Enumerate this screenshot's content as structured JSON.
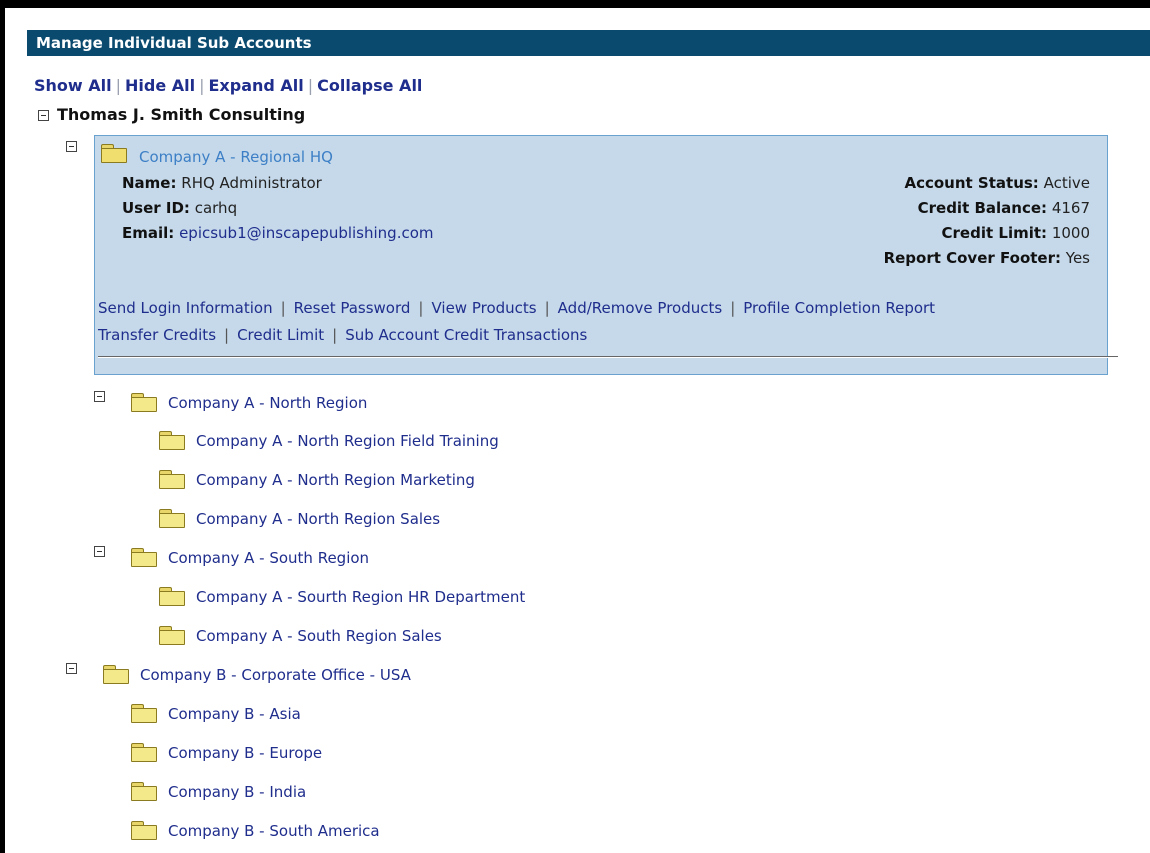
{
  "header": {
    "title": "Manage Individual Sub Accounts"
  },
  "toolbar": {
    "show_all": "Show All",
    "hide_all": "Hide All",
    "expand_all": "Expand All",
    "collapse_all": "Collapse All",
    "separator": "|"
  },
  "tree": {
    "root": {
      "label": "Thomas J. Smith Consulting"
    },
    "selected": {
      "label": "Company A - Regional HQ",
      "name_label": "Name:",
      "name_value": "RHQ Administrator",
      "userid_label": "User ID:",
      "userid_value": "carhq",
      "email_label": "Email:",
      "email_value": "epicsub1@inscapepublishing.com",
      "status_label": "Account Status:",
      "status_value": "Active",
      "balance_label": "Credit Balance:",
      "balance_value": "4167",
      "limit_label": "Credit Limit:",
      "limit_value": "1000",
      "footer_label": "Report Cover Footer:",
      "footer_value": "Yes",
      "actions_row1": [
        "Send Login Information",
        "Reset Password",
        "View Products",
        "Add/Remove Products",
        "Profile Completion Report"
      ],
      "actions_row2": [
        "Transfer Credits",
        "Credit Limit",
        "Sub Account Credit Transactions"
      ]
    },
    "north": {
      "label": "Company A - North Region",
      "children": [
        "Company A - North Region Field Training",
        "Company A - North Region Marketing",
        "Company A - North Region Sales"
      ]
    },
    "south": {
      "label": "Company A - South Region",
      "children": [
        "Company A - Sourth Region HR Department",
        "Company A - South Region Sales"
      ]
    },
    "companyb": {
      "label": "Company B - Corporate Office - USA",
      "children": [
        "Company B - Asia",
        "Company B - Europe",
        "Company B - India",
        "Company B - South America"
      ]
    }
  }
}
